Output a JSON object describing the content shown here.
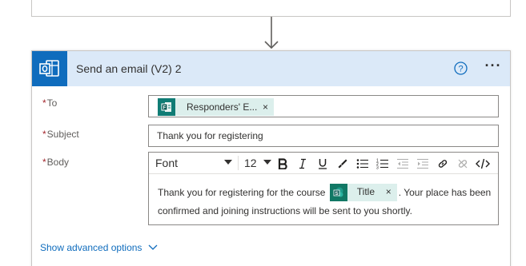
{
  "flow": {
    "previous_card": {},
    "action_card": {
      "title": "Send an email (V2) 2",
      "app_icon": "outlook-icon",
      "help_icon": "help-icon",
      "more_icon": "more-options-icon",
      "more_label": "···",
      "colors": {
        "header_bg": "#dbe9f8",
        "app_tile": "#0f6cbd",
        "token_bg": "#dcefec",
        "link": "#0f6cbd",
        "required": "#a4262c"
      }
    }
  },
  "fields": {
    "to": {
      "required_marker": "*",
      "label": "To",
      "token": {
        "label": "Responders' E...",
        "icon": "forms-icon",
        "remove": "×"
      }
    },
    "subject": {
      "required_marker": "*",
      "label": "Subject",
      "value": "Thank you for registering"
    },
    "body": {
      "required_marker": "*",
      "label": "Body",
      "toolbar": {
        "font": "Font",
        "size": "12",
        "buttons": [
          "bold-icon",
          "italic-icon",
          "underline-icon",
          "highlight-icon",
          "bullet-list-icon",
          "numbered-list-icon",
          "decrease-indent-icon",
          "increase-indent-icon",
          "link-icon",
          "unlink-icon",
          "code-view-icon"
        ]
      },
      "text_before": "Thank you for registering for the course",
      "token": {
        "label": "Title",
        "icon": "sharepoint-icon",
        "remove": "×"
      },
      "text_after": ". Your place has been confirmed and joining instructions will be sent to you shortly."
    }
  },
  "advanced": {
    "label": "Show advanced options",
    "icon": "chevron-down-icon"
  }
}
